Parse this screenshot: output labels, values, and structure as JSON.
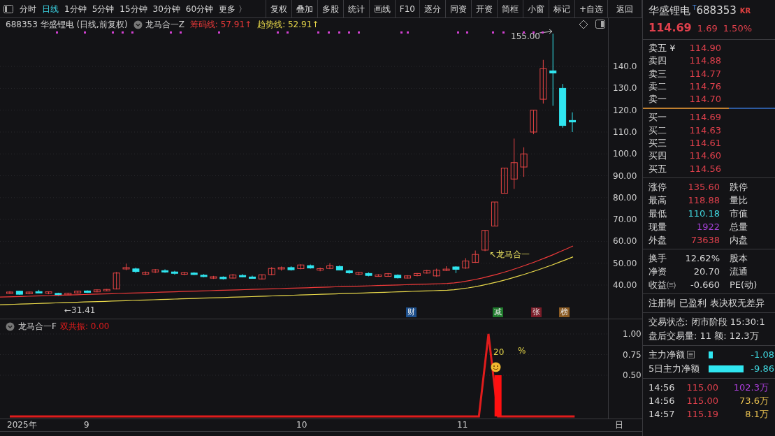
{
  "toolbar": {
    "periods": [
      {
        "label": "分时",
        "selected": false
      },
      {
        "label": "日线",
        "selected": true
      },
      {
        "label": "1分钟",
        "selected": false
      },
      {
        "label": "5分钟",
        "selected": false
      },
      {
        "label": "15分钟",
        "selected": false
      },
      {
        "label": "30分钟",
        "selected": false
      },
      {
        "label": "60分钟",
        "selected": false
      }
    ],
    "more": {
      "label": "更多",
      "arrow": "〉"
    },
    "buttons": [
      "复权",
      "叠加",
      "多股",
      "统计",
      "画线",
      "F10",
      "逐分",
      "同资",
      "开资",
      "简框",
      "小窗",
      "标记",
      "+自选",
      "返回"
    ]
  },
  "chart_header": {
    "title": "688353 华盛锂电 (日线,前复权)",
    "indicator": "龙马合一Z",
    "lines": [
      {
        "name": "筹码线:",
        "value": "57.91",
        "arrow": "↑",
        "color": "#f03a3a"
      },
      {
        "name": "趋势线:",
        "value": "52.91",
        "arrow": "↑",
        "color": "#e8d84a"
      }
    ]
  },
  "main_chart": {
    "high_label": "155.00",
    "low_label": "←31.41",
    "signal_label": "↖龙马合一",
    "chart_data": {
      "type": "candlestick",
      "grid": true,
      "ylim": [
        24.65,
        170.4
      ],
      "yticks": [
        {
          "value": 140,
          "label": "140.0"
        },
        {
          "value": 130,
          "label": "130.0"
        },
        {
          "value": 120,
          "label": "120.0"
        },
        {
          "value": 110,
          "label": "110.0"
        },
        {
          "value": 100,
          "label": "100.0"
        },
        {
          "value": 90,
          "label": "90.00"
        },
        {
          "value": 80,
          "label": "80.00"
        },
        {
          "value": 70,
          "label": "70.00"
        },
        {
          "value": 60,
          "label": "60.00"
        },
        {
          "value": 50,
          "label": "50.00"
        },
        {
          "value": 40,
          "label": "40.00"
        }
      ],
      "ohlc": [
        [
          36.5,
          37.2,
          36,
          36.8
        ],
        [
          37.2,
          37.4,
          35.6,
          35.8
        ],
        [
          36,
          37,
          35.8,
          36.8
        ],
        [
          37,
          37.8,
          36.4,
          36.6
        ],
        [
          36.4,
          37,
          35.8,
          36.9
        ],
        [
          36.2,
          36.5,
          35,
          35.3
        ],
        [
          35.5,
          36.5,
          35.2,
          36.3
        ],
        [
          36.4,
          37.4,
          36.1,
          37.2
        ],
        [
          37.3,
          37.6,
          36.4,
          36.7
        ],
        [
          36.9,
          38,
          36.7,
          37.8
        ],
        [
          37.8,
          38.2,
          37.2,
          38
        ],
        [
          38.2,
          46,
          38,
          45.5
        ],
        [
          47.5,
          49.8,
          46.8,
          48
        ],
        [
          47.4,
          48,
          45.5,
          46.2
        ],
        [
          45,
          46.2,
          44.6,
          45.8
        ],
        [
          46,
          47.3,
          45.5,
          47
        ],
        [
          46.6,
          47.2,
          45.6,
          46
        ],
        [
          46,
          46.5,
          44.8,
          45.4
        ],
        [
          45,
          46,
          44.5,
          45.6
        ],
        [
          45.5,
          45.9,
          44.6,
          44.8
        ],
        [
          44.5,
          45,
          43.6,
          43.9
        ],
        [
          43.5,
          44.2,
          42.8,
          43.8
        ],
        [
          43.6,
          44,
          42.5,
          42.9
        ],
        [
          43.2,
          45.1,
          43,
          44.6
        ],
        [
          44.4,
          45,
          43.5,
          43.8
        ],
        [
          43.7,
          44.3,
          43.2,
          43.5
        ],
        [
          42.8,
          44.9,
          42.5,
          44.7
        ],
        [
          44.8,
          48.2,
          44.5,
          47.6
        ],
        [
          47.5,
          48.5,
          46.6,
          48
        ],
        [
          48,
          48.6,
          46.6,
          47
        ],
        [
          47.5,
          49.5,
          47.2,
          49.2
        ],
        [
          48.9,
          49.4,
          47.5,
          47.8
        ],
        [
          47.2,
          48,
          46.3,
          47.5
        ],
        [
          47.6,
          50,
          47.3,
          48.8
        ],
        [
          48.5,
          49,
          46.7,
          46.9
        ],
        [
          46.5,
          47,
          45.2,
          45.6
        ],
        [
          45,
          46,
          44.5,
          45.8
        ],
        [
          45.3,
          45.8,
          44,
          44.4
        ],
        [
          44.2,
          45,
          43.8,
          44.6
        ],
        [
          44,
          45.5,
          43.8,
          45.2
        ],
        [
          44.5,
          44.9,
          43,
          43.3
        ],
        [
          43.2,
          44.5,
          43,
          44.2
        ],
        [
          44.3,
          45.5,
          44,
          45.3
        ],
        [
          45.5,
          47,
          45.2,
          46.6
        ],
        [
          44.2,
          47.5,
          43.8,
          46.8
        ],
        [
          47,
          48.6,
          46.5,
          47.3
        ],
        [
          48.3,
          48.6,
          45.5,
          47.2
        ],
        [
          47.8,
          52.3,
          47.4,
          51
        ],
        [
          50.4,
          55.8,
          50.2,
          54
        ],
        [
          56,
          65,
          55.5,
          65
        ],
        [
          67,
          78,
          67,
          78
        ],
        [
          82,
          93.5,
          82,
          93.5
        ],
        [
          88.5,
          107,
          84,
          96
        ],
        [
          94,
          103,
          89.5,
          100
        ],
        [
          110,
          120,
          109,
          120
        ],
        [
          125,
          143,
          123,
          139
        ],
        [
          138,
          155,
          122,
          137
        ],
        [
          130,
          132,
          112,
          113
        ],
        [
          115.3,
          119,
          110,
          114.6
        ]
      ]
    },
    "events": [
      {
        "label": "财",
        "color": "#1d4f8c"
      },
      {
        "label": "减",
        "color": "#1f7a2c"
      },
      {
        "label": "张",
        "color": "#7a1c28"
      },
      {
        "label": "榜",
        "color": "#8a5a22"
      }
    ]
  },
  "indicator": {
    "title": "龙马合一F",
    "series_value": "0.00",
    "pct_value": "20",
    "pct_sign": "%",
    "chart_data": {
      "type": "line",
      "yticks": [
        {
          "value": 0.5,
          "label": "0.50"
        },
        {
          "value": 0.75,
          "label": "0.75"
        },
        {
          "value": 1,
          "label": "1.00"
        }
      ],
      "ylim": [
        0,
        1
      ],
      "series": [
        {
          "name": "双共振:",
          "color": "#e01c1c",
          "values": [
            0,
            0,
            0,
            0,
            0,
            0,
            0,
            0,
            0,
            0,
            0,
            0,
            0,
            0,
            0,
            0,
            0,
            0,
            0,
            0,
            0,
            0,
            0,
            0,
            0,
            0,
            0,
            0,
            0,
            0,
            0,
            0,
            0,
            0,
            0,
            0,
            0,
            0,
            0,
            0,
            0,
            0,
            0,
            0,
            0,
            0,
            0,
            0,
            0,
            0,
            1,
            0,
            0,
            0,
            0,
            0,
            0,
            0,
            0,
            0
          ]
        },
        {
          "type": "bar",
          "color": "#ff1010",
          "values": [
            null,
            null,
            null,
            null,
            null,
            null,
            null,
            null,
            null,
            null,
            null,
            null,
            null,
            null,
            null,
            null,
            null,
            null,
            null,
            null,
            null,
            null,
            null,
            null,
            null,
            null,
            null,
            null,
            null,
            null,
            null,
            null,
            null,
            null,
            null,
            null,
            null,
            null,
            null,
            null,
            null,
            null,
            null,
            null,
            null,
            null,
            null,
            null,
            null,
            null,
            null,
            0.5,
            null,
            null,
            null,
            null,
            null,
            null,
            null,
            null
          ]
        }
      ]
    }
  },
  "x_axis": [
    "2025年",
    "9",
    "10",
    "11",
    "日"
  ],
  "quote": {
    "name": "华盛锂电",
    "badge": "T",
    "code": "688353",
    "tag": "KR",
    "price": "114.69",
    "change": "1.69",
    "percent": "1.50%"
  },
  "asks": [
    {
      "label": "卖五",
      "currency": "¥",
      "price": "114.90"
    },
    {
      "label": "卖四",
      "price": "114.88"
    },
    {
      "label": "卖三",
      "price": "114.77"
    },
    {
      "label": "卖二",
      "price": "114.76"
    },
    {
      "label": "卖一",
      "price": "114.70"
    }
  ],
  "bids": [
    {
      "label": "买一",
      "price": "114.69"
    },
    {
      "label": "买二",
      "price": "114.63"
    },
    {
      "label": "买三",
      "price": "114.61"
    },
    {
      "label": "买四",
      "price": "114.60"
    },
    {
      "label": "买五",
      "price": "114.56"
    }
  ],
  "stats": [
    [
      {
        "label": "涨停",
        "value": "135.60",
        "color": "#e0404c",
        "label2": "跌停"
      },
      {
        "label": "最高",
        "value": "118.88",
        "color": "#e0404c",
        "label2": "量比"
      },
      {
        "label": "最低",
        "value": "110.18",
        "color": "#40d8e0",
        "label2": "市值"
      },
      {
        "label": "现量",
        "value": "1922",
        "color": "#a040d0",
        "label2": "总量"
      },
      {
        "label": "外盘",
        "value": "73638",
        "color": "#e0404c",
        "label2": "内盘"
      }
    ],
    [
      {
        "label": "换手",
        "value": "12.62%",
        "color": "#d8d8d8",
        "label2": "股本"
      },
      {
        "label": "净资",
        "value": "20.70",
        "color": "#d8d8d8",
        "label2": "流通"
      },
      {
        "label": "收益㈢",
        "value": "-0.660",
        "color": "#d8d8d8",
        "label2": "PE(动)"
      }
    ]
  ],
  "tags": [
    "注册制",
    "已盈利",
    "表决权无差异"
  ],
  "status": [
    "交易状态: 闭市阶段 15:30:1",
    "盘后交易量: 11  额: 12.3万"
  ],
  "flows": [
    {
      "label": "主力净额",
      "menu": true,
      "value": "-1.08"
    },
    {
      "label": "5日主力净额",
      "menu": false,
      "value": "-9.86"
    }
  ],
  "ticks": [
    {
      "time": "14:56",
      "price": "115.00",
      "volume": "102.3万",
      "color": "#b040e0"
    },
    {
      "time": "14:56",
      "price": "115.00",
      "volume": "73.6万",
      "color": "#e8c050"
    },
    {
      "time": "14:57",
      "price": "115.19",
      "volume": "8.1万",
      "color": "#e8c050"
    }
  ]
}
